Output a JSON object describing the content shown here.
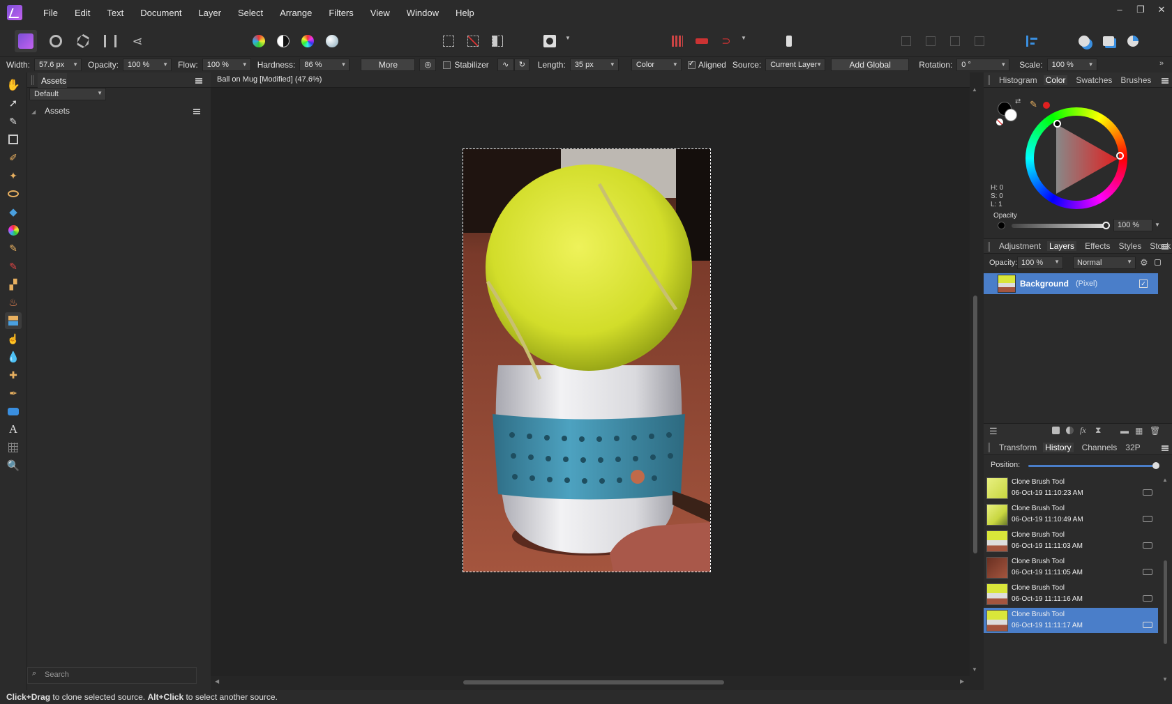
{
  "menubar": {
    "items": [
      "File",
      "Edit",
      "Text",
      "Document",
      "Layer",
      "Select",
      "Arrange",
      "Filters",
      "View",
      "Window",
      "Help"
    ]
  },
  "context": {
    "width_label": "Width:",
    "width_value": "57.6 px",
    "opacity_label": "Opacity:",
    "opacity_value": "100 %",
    "flow_label": "Flow:",
    "flow_value": "100 %",
    "hardness_label": "Hardness:",
    "hardness_value": "86 %",
    "more_label": "More",
    "stabilizer_label": "Stabilizer",
    "length_label": "Length:",
    "length_value": "35 px",
    "mode_value": "Color",
    "aligned_label": "Aligned",
    "source_label": "Source:",
    "source_value": "Current Layer",
    "add_global_source_label": "Add Global Source",
    "rotation_label": "Rotation:",
    "rotation_value": "0 °",
    "scale_label": "Scale:",
    "scale_value": "100 %"
  },
  "assets": {
    "tab": "Assets",
    "category": "Default",
    "section": "Assets",
    "search_placeholder": "Search"
  },
  "document": {
    "title": "Ball on Mug [Modified] (47.6%)"
  },
  "right": {
    "top_tabs": [
      "Histogram",
      "Color",
      "Swatches",
      "Brushes"
    ],
    "active_top_tab": "Color",
    "hsl": {
      "h": "H: 0",
      "s": "S: 0",
      "l": "L: 1"
    },
    "opacity_label": "Opacity",
    "opacity_value": "100 %",
    "mid_tabs": [
      "Adjustment",
      "Layers",
      "Effects",
      "Styles",
      "Stock"
    ],
    "active_mid_tab": "Layers",
    "layers_opacity_label": "Opacity:",
    "layers_opacity_value": "100 %",
    "blend_mode": "Normal",
    "layer_name": "Background",
    "layer_type": "(Pixel)",
    "bottom_tabs": [
      "Transform",
      "History",
      "Channels",
      "32P"
    ],
    "active_bottom_tab": "History",
    "position_label": "Position:",
    "history": [
      {
        "name": "Clone Brush Tool",
        "time": "06-Oct-19 11:10:23 AM"
      },
      {
        "name": "Clone Brush Tool",
        "time": "06-Oct-19 11:10:49 AM"
      },
      {
        "name": "Clone Brush Tool",
        "time": "06-Oct-19 11:11:03 AM"
      },
      {
        "name": "Clone Brush Tool",
        "time": "06-Oct-19 11:11:05 AM"
      },
      {
        "name": "Clone Brush Tool",
        "time": "06-Oct-19 11:11:16 AM"
      },
      {
        "name": "Clone Brush Tool",
        "time": "06-Oct-19 11:11:17 AM"
      }
    ]
  },
  "status": {
    "b1": "Click+Drag",
    "t1": " to clone selected source. ",
    "b2": "Alt+Click",
    "t2": " to select another source."
  },
  "colors": {
    "accent": "#4a7ec9",
    "ball": "#d9e63a",
    "mug_band": "#3d8ea8",
    "table": "#a4553e"
  }
}
